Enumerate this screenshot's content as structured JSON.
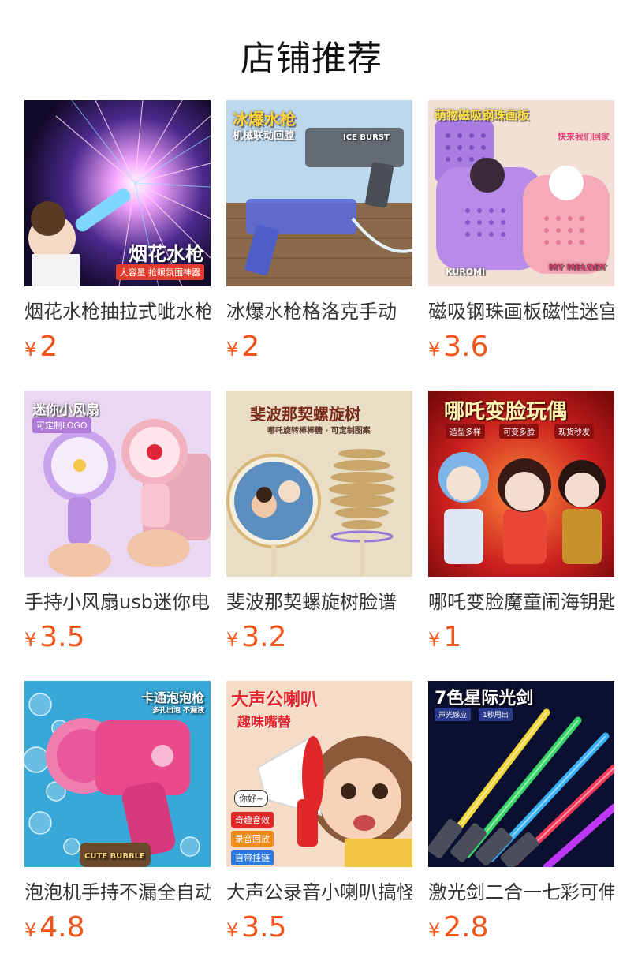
{
  "shop": {
    "title": "店铺推荐"
  },
  "colors": {
    "price": "#f0561c"
  },
  "currency": "¥",
  "products": [
    {
      "name": "烟花水枪抽拉式呲水枪",
      "price": "2",
      "badge": "烟花水枪",
      "sub": "大容量 抢眼氛围神器"
    },
    {
      "name": "冰爆水枪格洛克手动",
      "price": "2",
      "badge": "冰爆水枪",
      "sub": "机械联动回膛",
      "extra": "ICE BURST"
    },
    {
      "name": "磁吸钢珠画板磁性迷宫",
      "price": "3.6",
      "badge": "萌物磁吸钢珠画板",
      "sub": "快来我们回家",
      "extra": "KUROMI",
      "extra2": "MY MELODY"
    },
    {
      "name": "手持小风扇usb迷你电风扇",
      "price": "3.5",
      "badge": "迷你小风扇",
      "sub": "可定制LOGO"
    },
    {
      "name": "斐波那契螺旋树脸谱",
      "price": "3.2",
      "badge": "斐波那契螺旋树",
      "sub": "哪吒旋转棒棒糖 · 可定制图案"
    },
    {
      "name": "哪吒变脸魔童闹海钥匙扣",
      "price": "1",
      "badge": "哪吒变脸玩偶",
      "tags": [
        "造型多样",
        "可变多脸",
        "现货秒发"
      ]
    },
    {
      "name": "泡泡机手持不漏全自动",
      "price": "4.8",
      "badge": "卡通泡泡枪",
      "sub": "多孔出泡 不漏液",
      "extra": "CUTE BUBBLE"
    },
    {
      "name": "大声公录音小喇叭搞怪",
      "price": "3.5",
      "badge": "大声公喇叭",
      "sub": "趣味嘴替",
      "tags": [
        "奇趣音效",
        "录音回放",
        "自带挂链"
      ],
      "bubble": "你好~"
    },
    {
      "name": "激光剑二合一七彩可伸缩",
      "price": "2.8",
      "badge": "7色星际光剑",
      "tags": [
        "声光感应",
        "1秒甩出"
      ]
    }
  ]
}
